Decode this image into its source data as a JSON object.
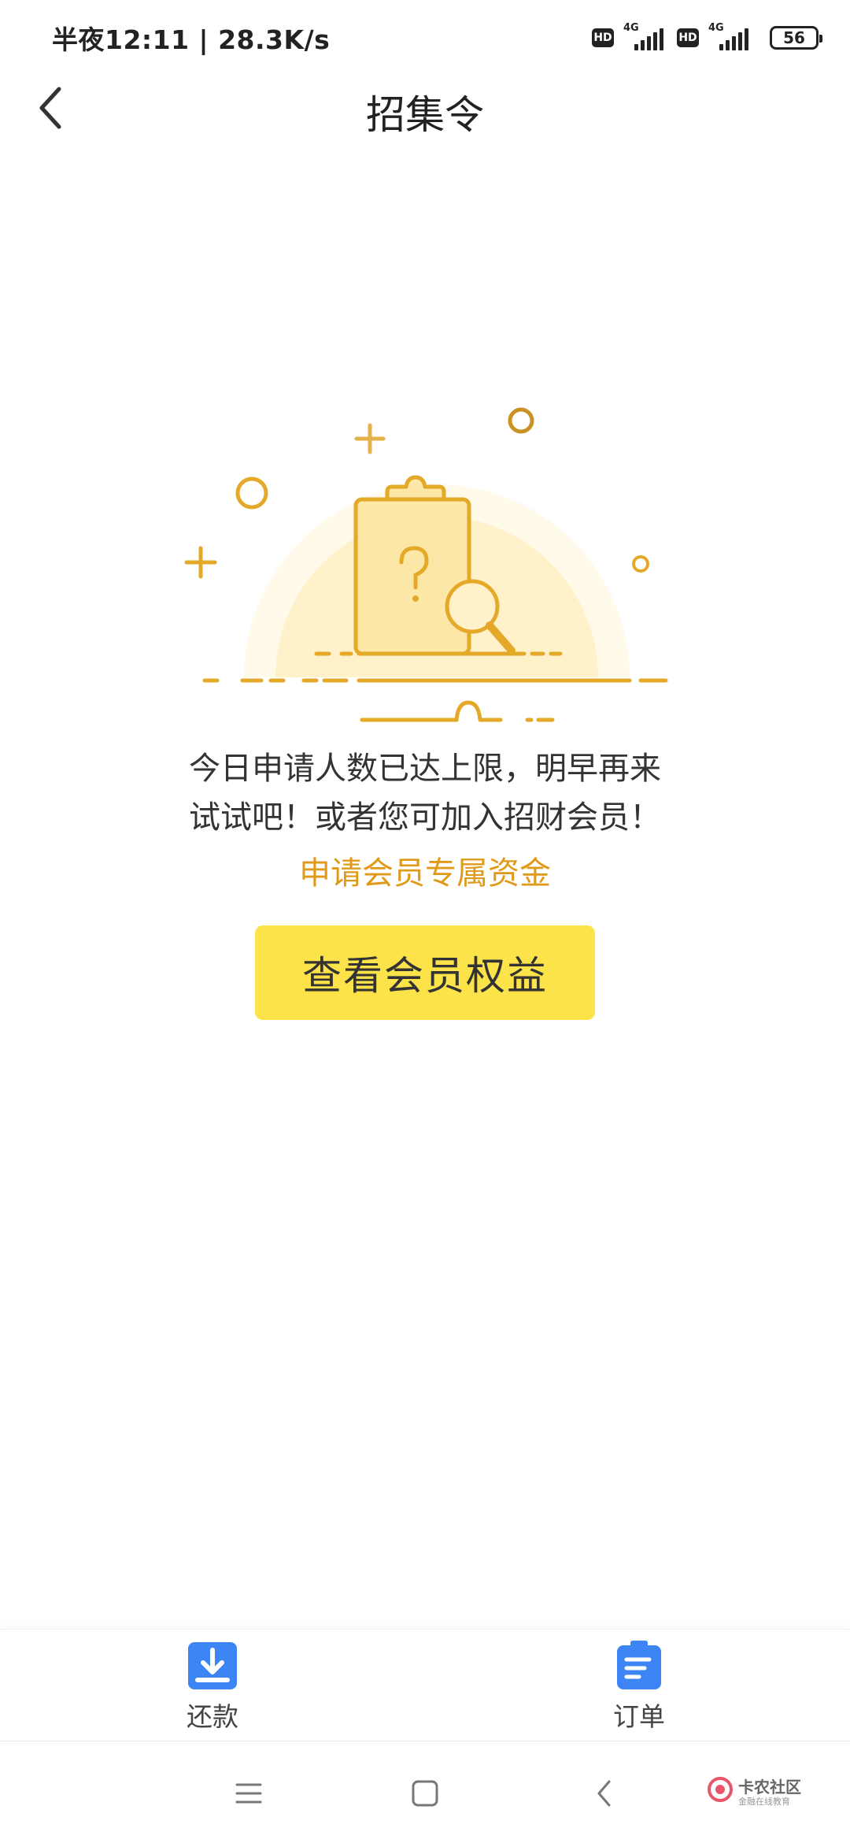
{
  "status_bar": {
    "time_speed": "半夜12:11 | 28.3K/s",
    "hd_label": "HD",
    "network_label": "4G",
    "battery": "56"
  },
  "header": {
    "title": "招集令",
    "back_icon": "chevron-left-icon"
  },
  "main": {
    "message_line1": "今日申请人数已达上限，明早再来",
    "message_line2": "试试吧！或者您可加入招财会员！",
    "member_link": "申请会员专属资金",
    "button_label": "查看会员权益",
    "illustration_icon": "clipboard-search-icon"
  },
  "tab_bar": {
    "items": [
      {
        "label": "还款",
        "icon": "download-icon"
      },
      {
        "label": "订单",
        "icon": "clipboard-icon"
      }
    ]
  },
  "watermark": {
    "title": "卡农社区",
    "subtitle": "金融在线教育"
  },
  "colors": {
    "accent_yellow": "#fde34a",
    "link_orange": "#e09a1a",
    "illustration_gold": "#e5a92a",
    "tab_blue": "#3d85f5"
  }
}
